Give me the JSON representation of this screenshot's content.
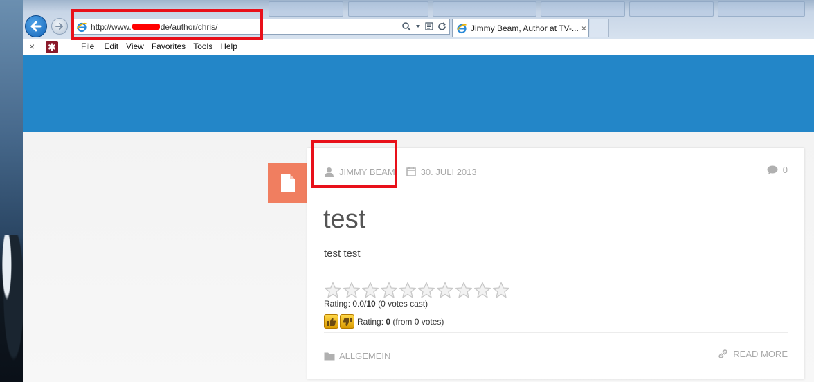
{
  "browser": {
    "url_prefix": "http://www.",
    "url_suffix": "de/author/chris/",
    "tab_title": "Jimmy Beam, Author at TV-...",
    "tab_close": "×",
    "menu_close": "×",
    "menu": [
      "File",
      "Edit",
      "View",
      "Favorites",
      "Tools",
      "Help"
    ]
  },
  "post": {
    "author": "JIMMY BEAM",
    "date": "30. JULI 2013",
    "comment_count": "0",
    "title": "test",
    "excerpt": "test test",
    "stars_total": 10,
    "rating_prefix": "Rating: 0.0/",
    "rating_max": "10",
    "rating_suffix": " (0 votes cast)",
    "thumbs_prefix": "Rating: ",
    "thumbs_value": "0",
    "thumbs_suffix": " (from 0 votes)",
    "category": "ALLGEMEIN",
    "read_more": "READ MORE"
  },
  "colors": {
    "hero": "#2386c8",
    "badge": "#f07e60",
    "annotation": "#e8101a"
  },
  "icons": [
    "back-arrow-icon",
    "forward-arrow-icon",
    "ie-icon",
    "search-icon",
    "refresh-icon",
    "user-icon",
    "calendar-icon",
    "comment-icon",
    "document-icon",
    "star-icon",
    "thumbs-up-icon",
    "thumbs-down-icon",
    "folder-icon",
    "link-icon"
  ]
}
